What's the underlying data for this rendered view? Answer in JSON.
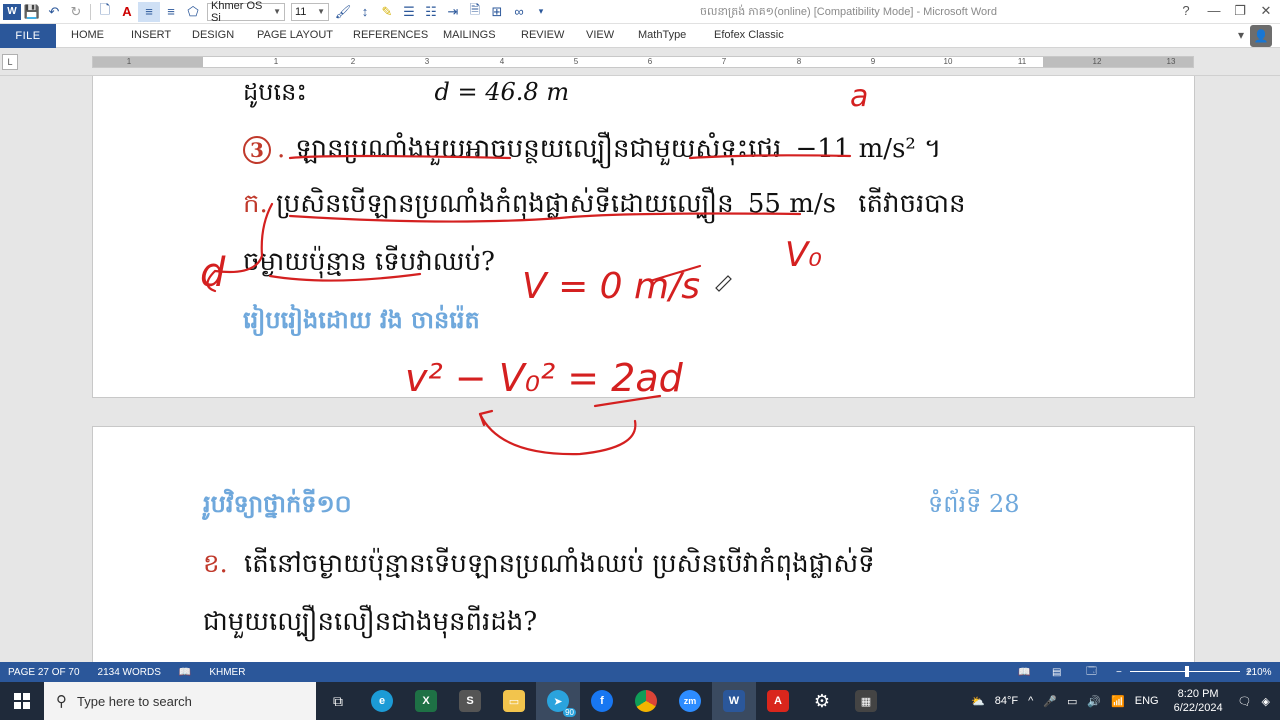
{
  "titlebar": {
    "font_name": "Khmer OS Si",
    "font_size": "11",
    "doc_title": "ចលនាត្រង់ ភាគ១(online) [Compatibility Mode] - Microsoft Word",
    "help": "?",
    "min": "—",
    "restore": "❐",
    "close": "✕"
  },
  "ribbon": {
    "file": "FILE",
    "tabs": [
      "HOME",
      "INSERT",
      "DESIGN",
      "PAGE LAYOUT",
      "REFERENCES",
      "MAILINGS",
      "REVIEW",
      "VIEW",
      "MathType",
      "Efofex Classic"
    ]
  },
  "ruler": {
    "ticks": [
      "1",
      "1",
      "2",
      "3",
      "4",
      "5",
      "6",
      "7",
      "8",
      "9",
      "10",
      "11",
      "12",
      "13"
    ]
  },
  "page1": {
    "top_line_left": "ដូបនេះ",
    "top_line_math": "d = 46.8 m",
    "q3_num": "3",
    "q3_text": "ឡានប្រណាំងមួយអាចបន្ថយល្បឿនជាមួយសំទុះថេរ",
    "q3_math": "−11 m/s² ។",
    "qa_label": "ក.",
    "qa_text": "ប្រសិនបើឡានប្រណាំងកំពុងផ្លាស់ទីដោយល្បឿន",
    "qa_math": "55 m/s",
    "qa_text2": "តើវាចរបាន",
    "qa_line2": "ចម្ងាយប៉ុន្មាន ទើបវាឈប់?",
    "author": "រៀបរៀងដោយ វង ចាន់រ៉េត"
  },
  "page2": {
    "header_left": "រូបវិទ្យាថ្នាក់ទី១០",
    "header_right": "ទំព័រទី 28",
    "qb_label": "ខ.",
    "qb_text": "តើនៅចម្ងាយប៉ុន្មានទើបឡានប្រណាំងឈប់ ប្រសិនបើវាកំពុងផ្លាស់ទី",
    "qb_line2": "ជាមួយល្បឿនលឿនជាងមុនពីរដង?"
  },
  "ink": {
    "a_label": "a",
    "v0_label": "V₀",
    "v_eq": "V = 0 m/s",
    "formula": "v² − V₀² = 2ad",
    "d_label": "d"
  },
  "statusbar": {
    "page": "PAGE 27 OF 70",
    "words": "2134 WORDS",
    "lang": "KHMER",
    "zoom": "210%"
  },
  "taskbar": {
    "search_placeholder": "Type here to search",
    "weather": "84°F",
    "lang": "ENG",
    "time": "8:20 PM",
    "date": "6/22/2024",
    "telegram_badge": "90"
  },
  "colors": {
    "word_blue": "#2b579a",
    "ink_red": "#d42020",
    "heading_blue": "#6fa8dc"
  }
}
